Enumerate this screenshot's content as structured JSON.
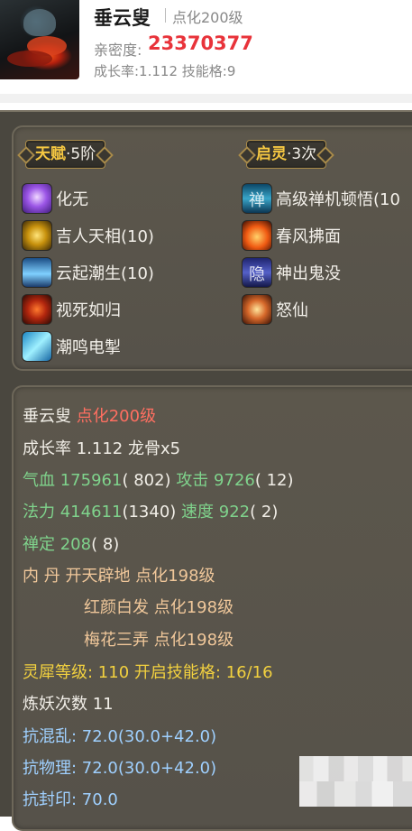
{
  "header": {
    "name": "垂云叟",
    "level": "点化200级",
    "intimacy_label": "亲密度:",
    "intimacy_value": "23370377",
    "growth_text": "成长率:1.112  技能格:9"
  },
  "talent": {
    "label": "天赋",
    "value": "·5阶"
  },
  "awaken": {
    "label": "启灵",
    "value": "·3次"
  },
  "skills_left": [
    {
      "name": "化无",
      "icon": "spirit-orb-icon"
    },
    {
      "name": "吉人天相(10)",
      "icon": "golden-blessing-icon"
    },
    {
      "name": "云起潮生(10)",
      "icon": "cloud-tide-icon"
    },
    {
      "name": "视死如归",
      "icon": "flame-skull-icon"
    },
    {
      "name": "潮鸣电掣",
      "icon": "lightning-wave-icon"
    }
  ],
  "skills_right": [
    {
      "name": "高级禅机顿悟(10",
      "icon": "zen-insight-icon",
      "glyph": "禅"
    },
    {
      "name": "春风拂面",
      "icon": "spring-breeze-icon"
    },
    {
      "name": "神出鬼没",
      "icon": "stealth-icon",
      "glyph": "隐"
    },
    {
      "name": "怒仙",
      "icon": "angry-immortal-icon"
    }
  ],
  "stats": {
    "name": "垂云叟",
    "level": "点化200级",
    "growth": "成长率 1.112 龙骨x5",
    "hp_label": "气血",
    "hp_value": "175961",
    "hp_bonus": "( 802)",
    "atk_label": "攻击",
    "atk_value": "9726",
    "atk_bonus": "( 12)",
    "mp_label": "法力",
    "mp_value": "414611",
    "mp_bonus": "(1340)",
    "spd_label": "速度",
    "spd_value": "922",
    "spd_bonus": "( 2)",
    "zen_label": "禅定",
    "zen_value": "208",
    "zen_bonus": "( 8)",
    "dan_label": "内    丹",
    "dan_1": "开天辟地 点化198级",
    "dan_2": "红颜白发 点化198级",
    "dan_3": "梅花三弄 点化198级",
    "lingxi": "灵犀等级: 110  开启技能格: 16/16",
    "lianyao": "炼妖次数 11",
    "res_chaos": "抗混乱: 72.0(30.0+42.0)",
    "res_phys": "抗物理: 72.0(30.0+42.0)",
    "res_seal": "抗封印: 70.0"
  }
}
